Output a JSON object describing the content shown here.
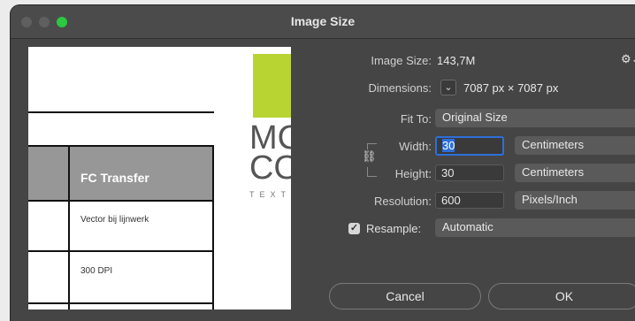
{
  "window": {
    "title": "Image Size"
  },
  "info": {
    "image_size_label": "Image Size:",
    "image_size_value": "143,7M",
    "dimensions_label": "Dimensions:",
    "dimensions_value": "7087 px  ×  7087 px"
  },
  "fit_to": {
    "label": "Fit To:",
    "value": "Original Size"
  },
  "width": {
    "label": "Width:",
    "value": "30",
    "unit": "Centimeters"
  },
  "height": {
    "label": "Height:",
    "value": "30",
    "unit": "Centimeters"
  },
  "resolution": {
    "label": "Resolution:",
    "value": "600",
    "unit": "Pixels/Inch"
  },
  "resample": {
    "label": "Resample:",
    "value": "Automatic",
    "checked": true
  },
  "buttons": {
    "cancel": "Cancel",
    "ok": "OK"
  },
  "preview": {
    "heading": "FC Transfer",
    "row1": "Vector bij lijnwerk",
    "row2": "300 DPI",
    "logo_line1": "MC",
    "logo_line2": "CO",
    "logo_small": "TEXTI"
  },
  "colors": {
    "accent": "#2d6fd9",
    "logo_green": "#b8d432",
    "traffic_green": "#2bc840"
  }
}
